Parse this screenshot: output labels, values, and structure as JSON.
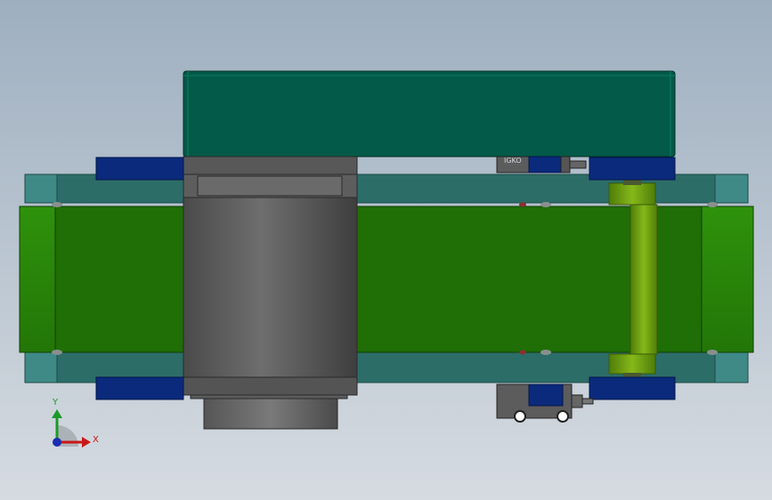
{
  "viewport": {
    "background_top": "#9eafc0",
    "background_bottom": "#d6dbe1"
  },
  "model": {
    "belt_color": "#1f6e06",
    "belt_end_color": "#2a8a0a",
    "frame_color": "#2c6d68",
    "frame_end_color": "#3f8a86",
    "cover_color": "#045a48",
    "mount_plate_color": "#0b2a7c",
    "motor_color": "#5a5a5a",
    "idler_color": "#6c9f12",
    "sensor_color": "#5c5c5c",
    "sensor_label": "IGKO"
  },
  "triad": {
    "y_label": "Y",
    "x_label": "X",
    "y_color": "#1c9a2a",
    "x_color": "#c81818",
    "z_color": "#1b2db0"
  }
}
